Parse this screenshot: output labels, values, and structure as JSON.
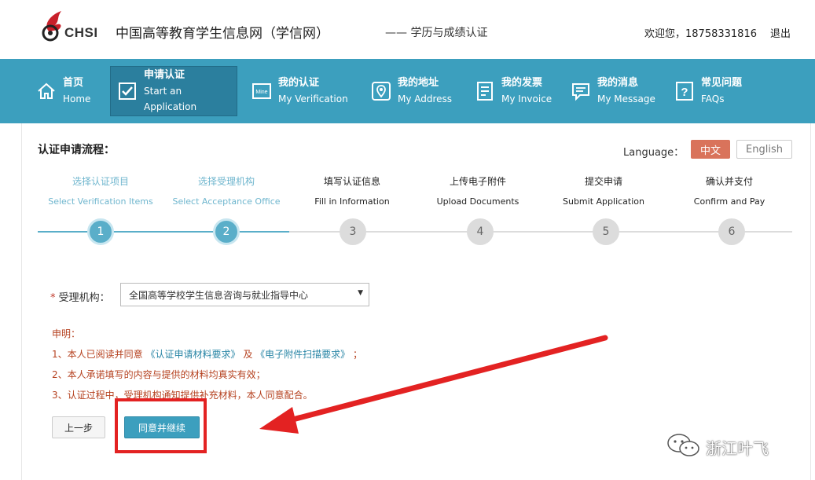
{
  "header": {
    "logo_text": "CHSI",
    "site_title": "中国高等教育学生信息网（学信网）",
    "site_subtitle": "—— 学历与成绩认证",
    "welcome": "欢迎您，18758331816",
    "logout": "退出"
  },
  "nav": {
    "items": [
      {
        "cn": "首页",
        "en": "Home",
        "icon": "home-icon"
      },
      {
        "cn": "申请认证",
        "en": "Start an Application",
        "icon": "checkbox-icon",
        "active": true
      },
      {
        "cn": "我的认证",
        "en": "My Verification",
        "icon": "mine-icon"
      },
      {
        "cn": "我的地址",
        "en": "My Address",
        "icon": "location-icon"
      },
      {
        "cn": "我的发票",
        "en": "My Invoice",
        "icon": "invoice-icon"
      },
      {
        "cn": "我的消息",
        "en": "My Message",
        "icon": "message-icon"
      },
      {
        "cn": "常见问题",
        "en": "FAQs",
        "icon": "question-icon"
      }
    ]
  },
  "process": {
    "title": "认证申请流程：",
    "language_label": "Language：",
    "lang_zh": "中文",
    "lang_en": "English",
    "current_step": 2,
    "steps": [
      {
        "cn": "选择认证项目",
        "en": "Select Verification Items",
        "num": "1"
      },
      {
        "cn": "选择受理机构",
        "en": "Select Acceptance Office",
        "num": "2"
      },
      {
        "cn": "填写认证信息",
        "en": "Fill in Information",
        "num": "3"
      },
      {
        "cn": "上传电子附件",
        "en": "Upload Documents",
        "num": "4"
      },
      {
        "cn": "提交申请",
        "en": "Submit Application",
        "num": "5"
      },
      {
        "cn": "确认并支付",
        "en": "Confirm and Pay",
        "num": "6"
      }
    ]
  },
  "form": {
    "required_mark": "*",
    "agency_label": "受理机构：",
    "agency_value": "全国高等学校学生信息咨询与就业指导中心"
  },
  "declaration": {
    "title": "申明：",
    "line1_prefix": "1、本人已阅读并同意",
    "link1": "《认证申请材料要求》",
    "line1_mid": "及",
    "link2": "《电子附件扫描要求》",
    "line1_suffix": "；",
    "line2": "2、本人承诺填写的内容与提供的材料均真实有效；",
    "line3": "3、认证过程中，受理机构通知提供补充材料，本人同意配合。"
  },
  "buttons": {
    "prev": "上一步",
    "agree": "同意并继续"
  },
  "watermark": {
    "text": "浙江叶飞"
  },
  "colors": {
    "nav_bg": "#3c9fbe",
    "nav_active": "#2b7f9e",
    "accent_red": "#e32222",
    "lang_active": "#d9735b"
  }
}
